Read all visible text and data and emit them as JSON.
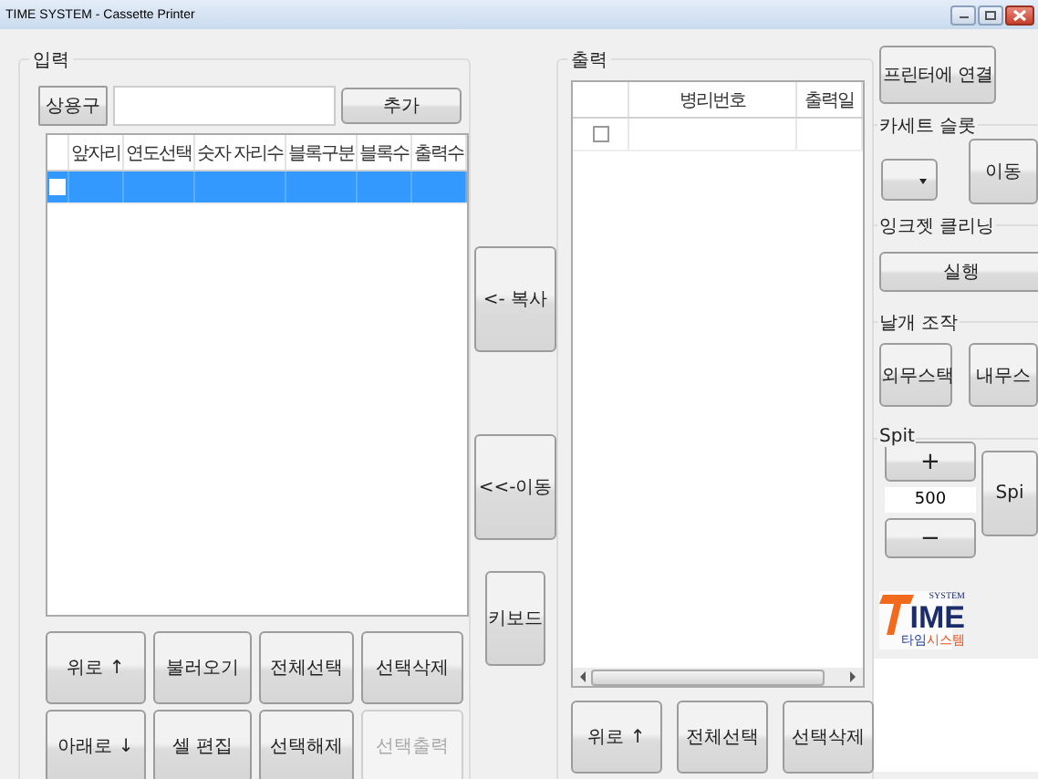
{
  "window": {
    "title": "TIME SYSTEM - Cassette Printer"
  },
  "input": {
    "title": "입력",
    "phrase_button": "상용구",
    "add_button": "추가",
    "table": {
      "columns": [
        "앞자리",
        "연도선택",
        "숫자 자리수",
        "블록구분",
        "블록수",
        "출력수"
      ],
      "rows": [
        {
          "checked": false,
          "selected": true
        }
      ]
    },
    "buttons": [
      {
        "label": "위로  ↑",
        "disabled": false
      },
      {
        "label": "불러오기",
        "disabled": false
      },
      {
        "label": "전체선택",
        "disabled": false
      },
      {
        "label": "선택삭제",
        "disabled": false
      },
      {
        "label": "아래로 ↓",
        "disabled": false
      },
      {
        "label": "셀 편집",
        "disabled": false
      },
      {
        "label": "선택해제",
        "disabled": false
      },
      {
        "label": "선택출력",
        "disabled": true
      }
    ]
  },
  "transfer_buttons": [
    "<- 복사",
    "<<-이동",
    "키보드"
  ],
  "output": {
    "title": "출력",
    "table": {
      "columns": [
        "병리번호",
        "출력일"
      ],
      "rows": [
        {
          "checked": false,
          "selected": false
        }
      ]
    },
    "buttons": [
      "위로  ↑",
      "전체선택",
      "선택삭제"
    ]
  },
  "side": {
    "connect_button": "프린터에 연결",
    "cassette_slot": {
      "title": "카세트 슬롯",
      "move_button": "이동"
    },
    "inkjet": {
      "title": "잉크젯 클리닝",
      "run_button": "실행"
    },
    "wing": {
      "title": "날개 조작",
      "buttons": [
        "외무스택",
        "내무스"
      ]
    },
    "spit": {
      "title": "Spit",
      "plus": "+",
      "value": "500",
      "minus": "−",
      "button": "Spi"
    },
    "logo": {
      "tag": "SYSTEM",
      "word": "IME",
      "name_1": "타임",
      "name_2": "시스템"
    }
  }
}
